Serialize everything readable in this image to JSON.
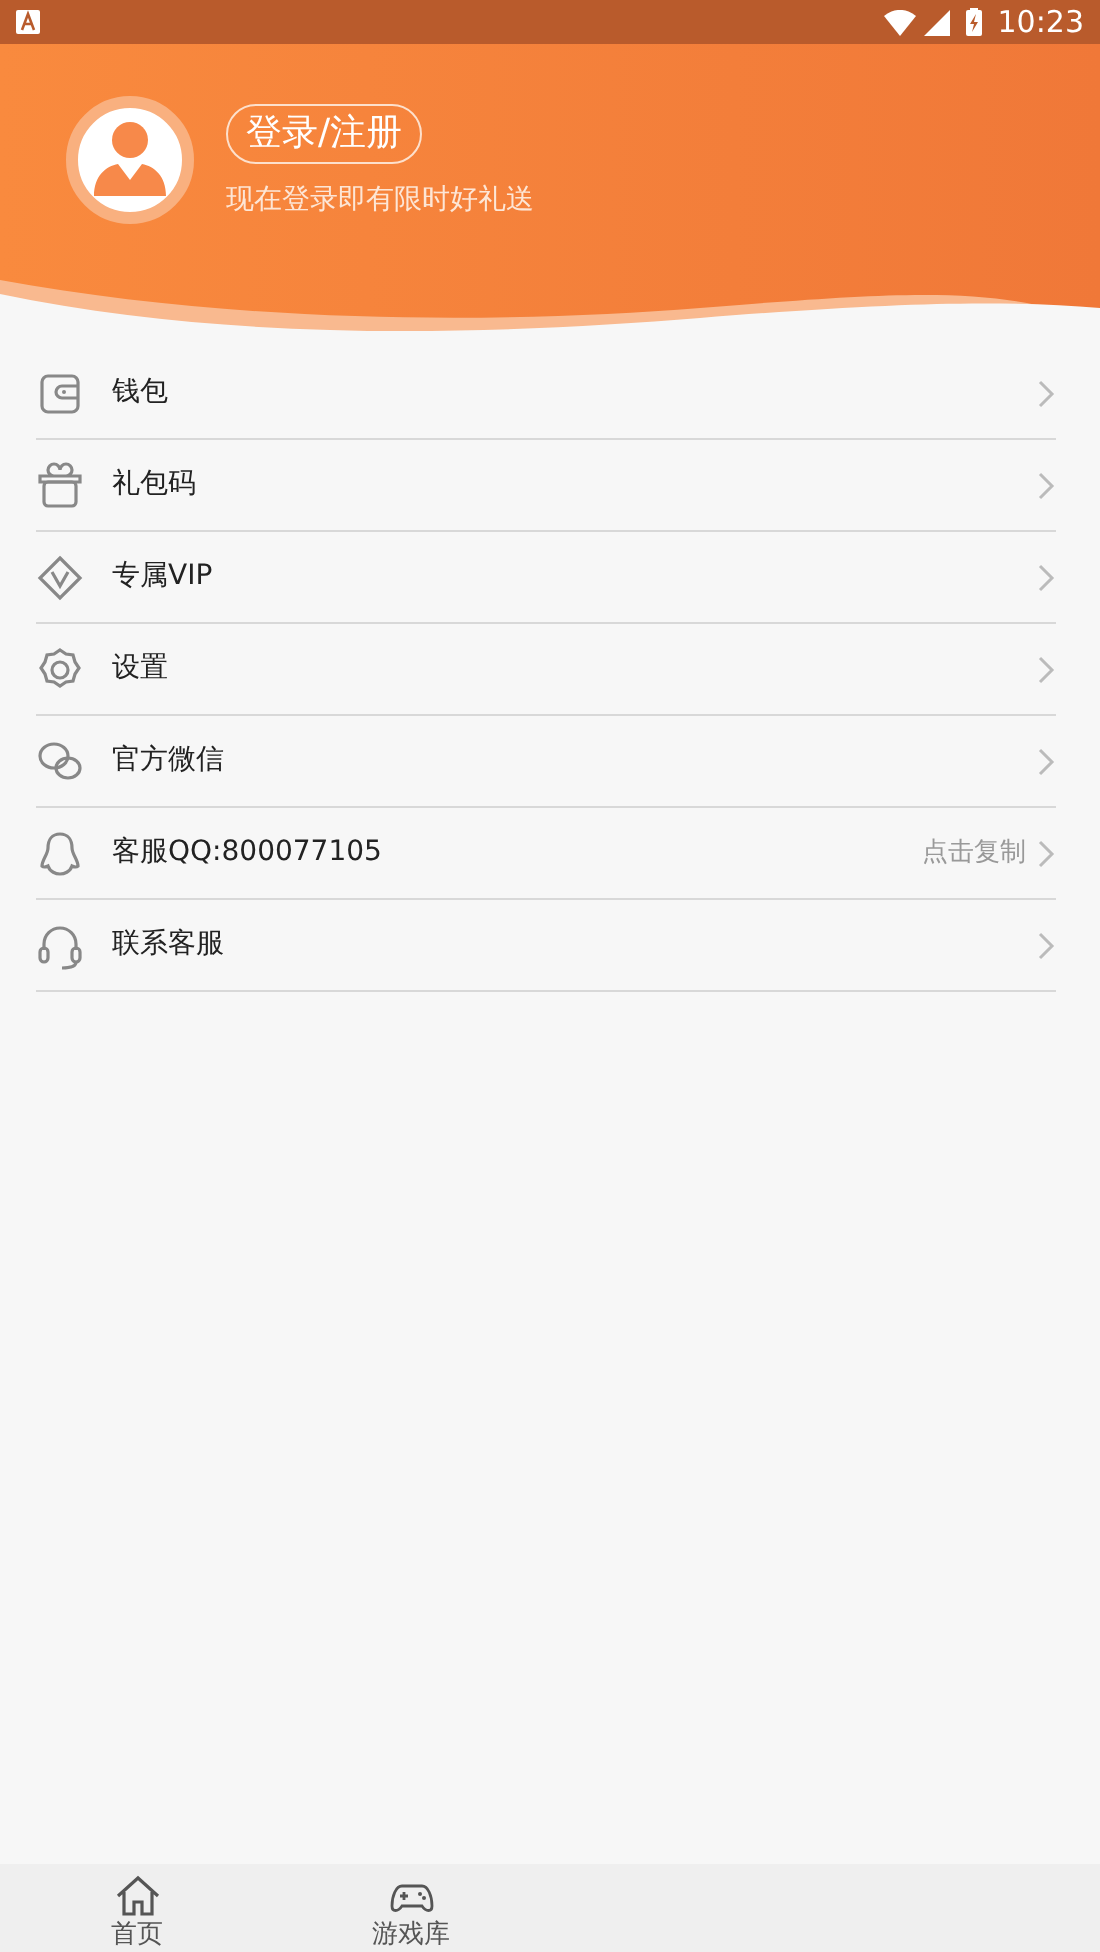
{
  "status_bar": {
    "time": "10:23"
  },
  "profile": {
    "login_button": "登录/注册",
    "promo": "现在登录即有限时好礼送"
  },
  "menu": [
    {
      "label": "钱包"
    },
    {
      "label": "礼包码"
    },
    {
      "label": "专属VIP"
    },
    {
      "label": "设置"
    },
    {
      "label": "官方微信"
    },
    {
      "label": "客服QQ:800077105",
      "hint": "点击复制"
    },
    {
      "label": "联系客服"
    }
  ],
  "tab_bar": [
    {
      "label": "首页",
      "selected": false
    },
    {
      "label": "游戏库",
      "selected": false
    }
  ]
}
